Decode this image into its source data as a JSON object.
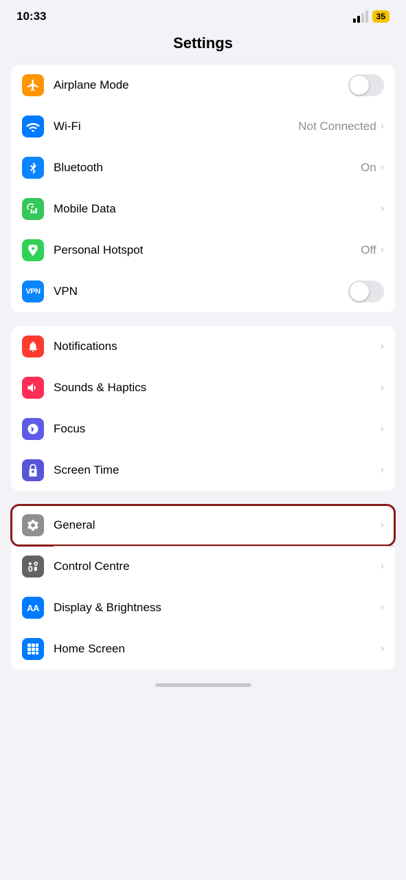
{
  "statusBar": {
    "time": "10:33",
    "batteryLevel": "35"
  },
  "pageTitle": "Settings",
  "groups": [
    {
      "id": "connectivity",
      "rows": [
        {
          "id": "airplane-mode",
          "label": "Airplane Mode",
          "value": "",
          "hasToggle": true,
          "toggleOn": false,
          "hasChevron": false,
          "iconBg": "bg-orange",
          "iconSymbol": "✈"
        },
        {
          "id": "wifi",
          "label": "Wi-Fi",
          "value": "Not Connected",
          "hasToggle": false,
          "hasChevron": true,
          "iconBg": "bg-blue",
          "iconSymbol": "wifi"
        },
        {
          "id": "bluetooth",
          "label": "Bluetooth",
          "value": "On",
          "hasToggle": false,
          "hasChevron": true,
          "iconBg": "bg-bluetooth",
          "iconSymbol": "bluetooth"
        },
        {
          "id": "mobile-data",
          "label": "Mobile Data",
          "value": "",
          "hasToggle": false,
          "hasChevron": true,
          "iconBg": "bg-green",
          "iconSymbol": "signal"
        },
        {
          "id": "personal-hotspot",
          "label": "Personal Hotspot",
          "value": "Off",
          "hasToggle": false,
          "hasChevron": true,
          "iconBg": "bg-green2",
          "iconSymbol": "hotspot"
        },
        {
          "id": "vpn",
          "label": "VPN",
          "value": "",
          "hasToggle": true,
          "toggleOn": false,
          "hasChevron": false,
          "iconBg": "bg-blue-vpn",
          "iconSymbol": "vpn"
        }
      ]
    },
    {
      "id": "notifications-sounds",
      "rows": [
        {
          "id": "notifications",
          "label": "Notifications",
          "value": "",
          "hasToggle": false,
          "hasChevron": true,
          "iconBg": "bg-red",
          "iconSymbol": "bell"
        },
        {
          "id": "sounds-haptics",
          "label": "Sounds & Haptics",
          "value": "",
          "hasToggle": false,
          "hasChevron": true,
          "iconBg": "bg-pink-red",
          "iconSymbol": "sound"
        },
        {
          "id": "focus",
          "label": "Focus",
          "value": "",
          "hasToggle": false,
          "hasChevron": true,
          "iconBg": "bg-purple",
          "iconSymbol": "moon"
        },
        {
          "id": "screen-time",
          "label": "Screen Time",
          "value": "",
          "hasToggle": false,
          "hasChevron": true,
          "iconBg": "bg-indigo",
          "iconSymbol": "hourglass"
        }
      ]
    },
    {
      "id": "general-display",
      "rows": [
        {
          "id": "general",
          "label": "General",
          "value": "",
          "hasToggle": false,
          "hasChevron": true,
          "iconBg": "bg-gray",
          "iconSymbol": "gear",
          "selected": true
        },
        {
          "id": "control-centre",
          "label": "Control Centre",
          "value": "",
          "hasToggle": false,
          "hasChevron": true,
          "iconBg": "bg-gray2",
          "iconSymbol": "sliders"
        },
        {
          "id": "display-brightness",
          "label": "Display & Brightness",
          "value": "",
          "hasToggle": false,
          "hasChevron": true,
          "iconBg": "bg-blue2",
          "iconSymbol": "AA"
        },
        {
          "id": "home-screen",
          "label": "Home Screen",
          "value": "",
          "hasToggle": false,
          "hasChevron": true,
          "iconBg": "bg-homescreen",
          "iconSymbol": "dots"
        }
      ]
    }
  ]
}
